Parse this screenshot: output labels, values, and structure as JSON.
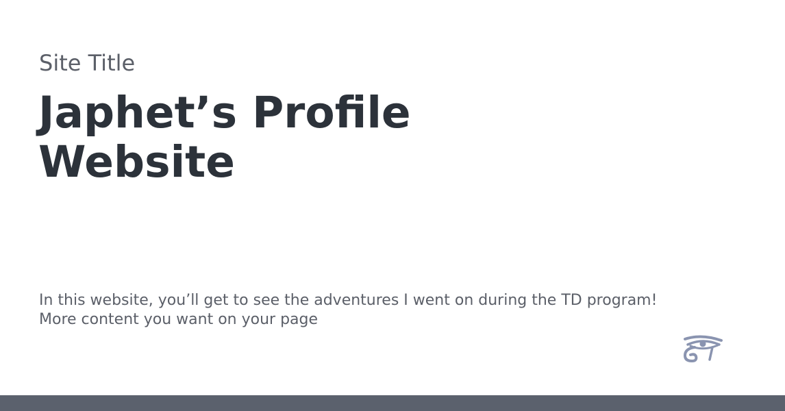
{
  "header": {
    "site_title": "Site Title",
    "headline": "Japhet’s Profile Website"
  },
  "main": {
    "lines": [
      "In this website, you’ll get to see the adventures I went on during the TD program!",
      "More content you want on your page"
    ]
  },
  "decor": {
    "icon": "eye-of-horus-icon",
    "icon_color": "#8a94b0"
  },
  "footer": {
    "bar_color": "#5b616d"
  }
}
